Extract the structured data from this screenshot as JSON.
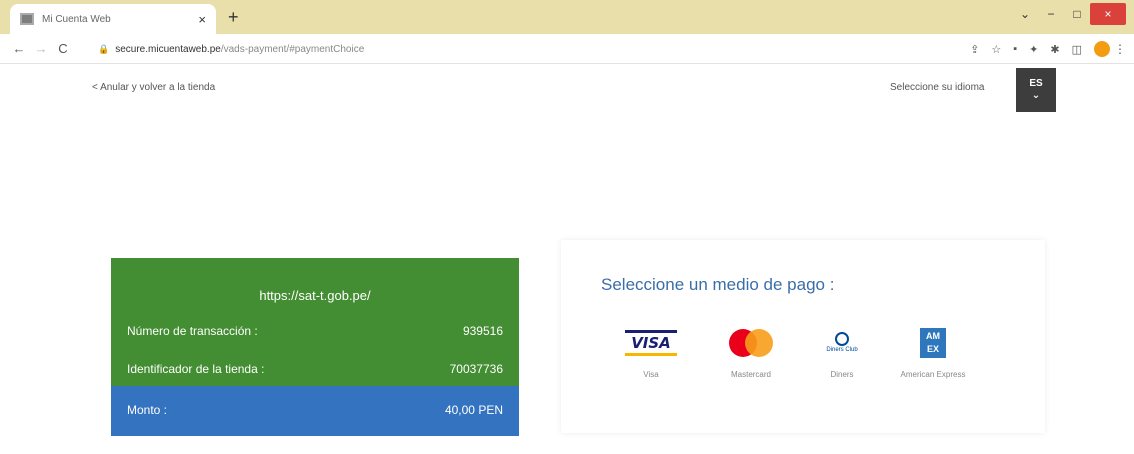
{
  "browser": {
    "tab_title": "Mi Cuenta Web",
    "tab_close": "×",
    "new_tab": "+",
    "url_host": "secure.micuentaweb.pe",
    "url_path": "/vads-payment/#paymentChoice",
    "window_minimize": "−",
    "window_maximize": "□",
    "window_close": "×",
    "collapse": "⌄"
  },
  "page": {
    "back_link": "< Anular y volver a la tienda",
    "language_label": "Seleccione su idioma",
    "language_code": "ES",
    "language_chevron": "⌄"
  },
  "order": {
    "shop_url": "https://sat-t.gob.pe/",
    "transaction_label": "Número de transacción :",
    "transaction_value": "939516",
    "shop_id_label": "Identificador de la tienda :",
    "shop_id_value": "70037736",
    "amount_label": "Monto :",
    "amount_value": "40,00 PEN"
  },
  "payment": {
    "title": "Seleccione un medio de pago :",
    "methods": [
      {
        "label": "Visa",
        "logo_text": "VISA"
      },
      {
        "label": "Mastercard"
      },
      {
        "label": "Diners",
        "logo_text": "Diners Club"
      },
      {
        "label": "American Express",
        "logo_text": "AM EX"
      }
    ]
  },
  "colors": {
    "tab_strip": "#e9dfaa",
    "order_green": "#438d32",
    "amount_blue": "#3473c0",
    "title_blue": "#3b6ea8",
    "visa_blue": "#1a1f71",
    "visa_gold": "#f7b600",
    "mc_red": "#eb001b",
    "mc_orange": "#f79e1b",
    "amex_blue": "#2e77bc"
  },
  "icons": [
    "back-arrow-icon",
    "forward-arrow-icon",
    "reload-icon",
    "lock-icon",
    "share-icon",
    "star-icon",
    "extension-icon",
    "puzzle-icon",
    "sidepanel-icon",
    "profile-avatar",
    "more-icon"
  ]
}
